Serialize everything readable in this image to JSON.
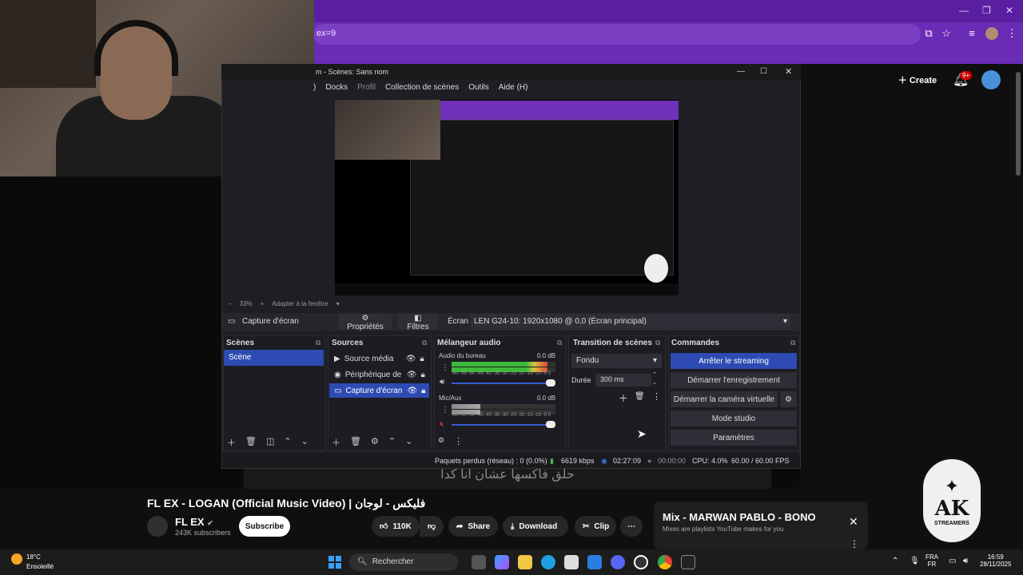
{
  "browser": {
    "address_fragment": "ex=9",
    "window_controls": [
      "—",
      "❐",
      "✕"
    ]
  },
  "youtube": {
    "create_label": "Create",
    "notif_count": "9+",
    "lyrics_text": "حلق فاكسها عشان أنا كدا",
    "video_title": "FL EX - LOGAN (Official Music Video) | فليكس - لوجان",
    "channel_name": "FL EX",
    "subscribers": "243K subscribers",
    "subscribe_label": "Subscribe",
    "likes": "110K",
    "share_label": "Share",
    "download_label": "Download",
    "clip_label": "Clip",
    "mix_title": "Mix - MARWAN PABLO - BONO",
    "mix_subtitle": "Mixes are playlists YouTube makes for you"
  },
  "obs": {
    "title": "m - Scènes: Sans nom",
    "menu": [
      ") ",
      "Docks",
      "Profil",
      "Collection de scènes",
      "Outils",
      "Aide (H)"
    ],
    "zoom": "33%",
    "fit_label": "Adapter à la fenêtre",
    "toolbar": {
      "source_name": "Capture d'écran",
      "properties": "Propriétés",
      "filters": "Filtres",
      "screen_label": "Écran",
      "screen_value": "LEN G24-10: 1920x1080 @ 0,0 (Écran principal)"
    },
    "docks": {
      "scenes_title": "Scènes",
      "sources_title": "Sources",
      "mixer_title": "Mélangeur audio",
      "transitions_title": "Transition de scènes",
      "commands_title": "Commandes"
    },
    "scene_items": [
      "Scène"
    ],
    "sources": [
      "Source média",
      "Périphérique de c",
      "Capture d'écran"
    ],
    "mixer": [
      {
        "name": "Audio du bureau",
        "db": "0.0 dB",
        "level": 0.92
      },
      {
        "name": "Mic/Aux",
        "db": "0.0 dB",
        "level": 0.28
      }
    ],
    "meter_scale": "-60 -55 -50 -45 -40 -35 -30 -25 -20 -15 -10 -5 0",
    "transition": "Fondu",
    "duration_label": "Durée",
    "duration_value": "300 ms",
    "commands": [
      "Arrêter le streaming",
      "Démarrer l'enregistrement",
      "Démarrer la caméra virtuelle",
      "Mode studio",
      "Paramètres"
    ],
    "status": {
      "dropped": "Paquets perdus (réseau) : 0 (0.0%)",
      "bitrate": "6619 kbps",
      "stream_time": "02:27:09",
      "rec_time": "00:00:00",
      "cpu": "CPU: 4.0%",
      "fps": "60.00 / 60.00 FPS"
    }
  },
  "logo": {
    "big": "AK",
    "small": "STREAMERS"
  },
  "taskbar": {
    "temperature": "18°C",
    "weather": "Ensoleillé",
    "search_label": "Rechercher",
    "lang1": "FRA",
    "lang2": "FR",
    "time": "16:59",
    "date": "28/11/2025"
  },
  "colors": {
    "obs_accent": "#2d4bb3",
    "browser_purple": "#6a2bb5"
  }
}
